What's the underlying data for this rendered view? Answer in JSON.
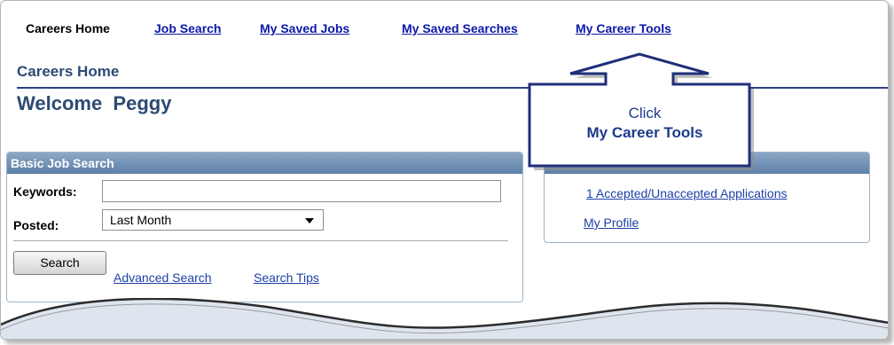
{
  "nav": {
    "current": "Careers Home",
    "links": [
      "Job Search",
      "My Saved Jobs",
      "My Saved Searches",
      "My Career Tools"
    ]
  },
  "page": {
    "breadcrumb": "Careers Home",
    "welcome": "Welcome  Peggy"
  },
  "basic_search": {
    "title": "Basic Job Search",
    "keywords_label": "Keywords:",
    "keywords_value": "",
    "posted_label": "Posted:",
    "posted_value": "Last Month",
    "search_button": "Search",
    "advanced_link": "Advanced Search",
    "tips_link": "Search Tips"
  },
  "right_panel": {
    "applications_link": "1 Accepted/Unaccepted Applications",
    "profile_link": "My Profile"
  },
  "callout": {
    "line1": "Click",
    "line2": "My Career Tools"
  },
  "colors": {
    "link": "#0b18a8",
    "heading": "#2c4a73",
    "panel_header": "#6f8db3",
    "callout_border": "#1f2f7a"
  }
}
